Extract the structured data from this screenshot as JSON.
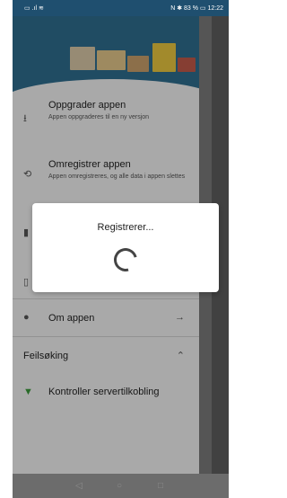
{
  "status": {
    "left": "▭ .ıl ≋",
    "right": "N ✱ 83 % ▭ 12:22"
  },
  "drawer": {
    "items": [
      {
        "title": "Oppgrader appen",
        "subtitle": "Appen oppgraderes til en ny versjon"
      },
      {
        "title": "Omregistrer appen",
        "subtitle": "Appen omregistreres, og alle data i appen slettes"
      },
      {
        "title": "Om appen",
        "subtitle": ""
      }
    ],
    "section": {
      "label": "Feilsøking"
    },
    "check": {
      "label": "Kontroller servertilkobling"
    }
  },
  "dialog": {
    "title": "Registrerer..."
  },
  "nav": {
    "back": "◁",
    "home": "○",
    "recents": "□"
  },
  "colors": {
    "header": "#2f6d8f",
    "overlay": "rgba(0,0,0,0.30)",
    "check_icon": "#3c9a3c"
  }
}
